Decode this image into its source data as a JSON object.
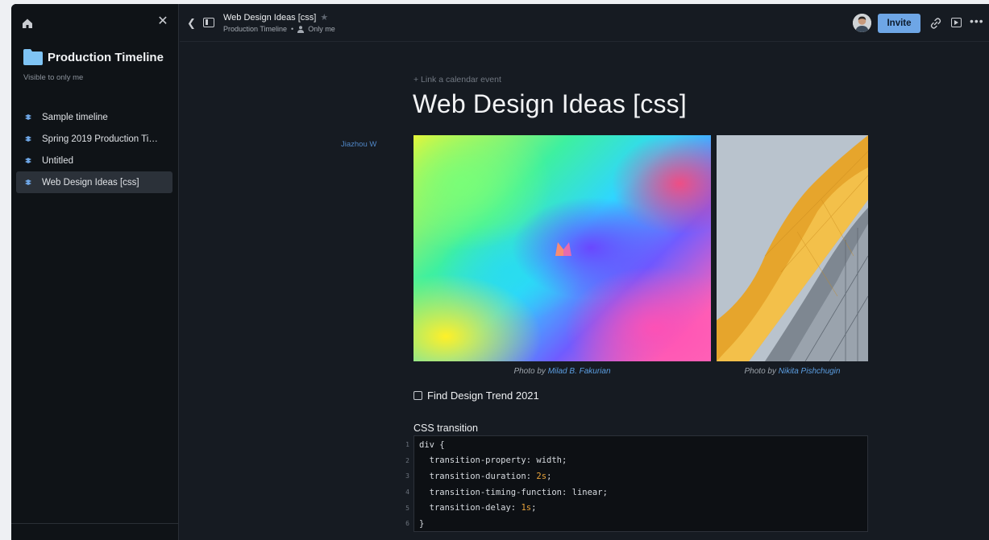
{
  "sidebar": {
    "folder_title": "Production Timeline",
    "visibility": "Visible to only me",
    "items": [
      {
        "label": "Sample timeline"
      },
      {
        "label": "Spring 2019 Production Tim..."
      },
      {
        "label": "Untitled"
      },
      {
        "label": "Web Design Ideas [css]"
      }
    ],
    "active_index": 3
  },
  "topbar": {
    "doc_title": "Web Design Ideas [css]",
    "breadcrumb_folder": "Production Timeline",
    "breadcrumb_sep": "•",
    "sharing": "Only me",
    "invite_label": "Invite"
  },
  "main": {
    "link_calendar": "+ Link a calendar event",
    "title": "Web Design Ideas [css]",
    "author": "Jiazhou W",
    "images": [
      {
        "caption_prefix": "Photo by",
        "photographer": "Milad B. Fakurian"
      },
      {
        "caption_prefix": "Photo by",
        "photographer": "Nikita Pishchugin"
      }
    ],
    "todo": {
      "label": "Find Design Trend 2021",
      "checked": false
    },
    "code": {
      "heading": "CSS transition",
      "lines": [
        {
          "no": "1",
          "text": "div {"
        },
        {
          "no": "2",
          "text": "  transition-property: width;"
        },
        {
          "no": "3",
          "pre": "  transition-duration: ",
          "num": "2s",
          "post": ";"
        },
        {
          "no": "4",
          "text": "  transition-timing-function: linear;"
        },
        {
          "no": "5",
          "pre": "  transition-delay: ",
          "num": "1s",
          "post": ";"
        },
        {
          "no": "6",
          "text": "}"
        }
      ]
    }
  },
  "colors": {
    "accent": "#6ea6e6",
    "link": "#5b9de0",
    "code_number": "#e9a33b",
    "background": "#161b22",
    "sidebar_bg": "#0f1317"
  }
}
